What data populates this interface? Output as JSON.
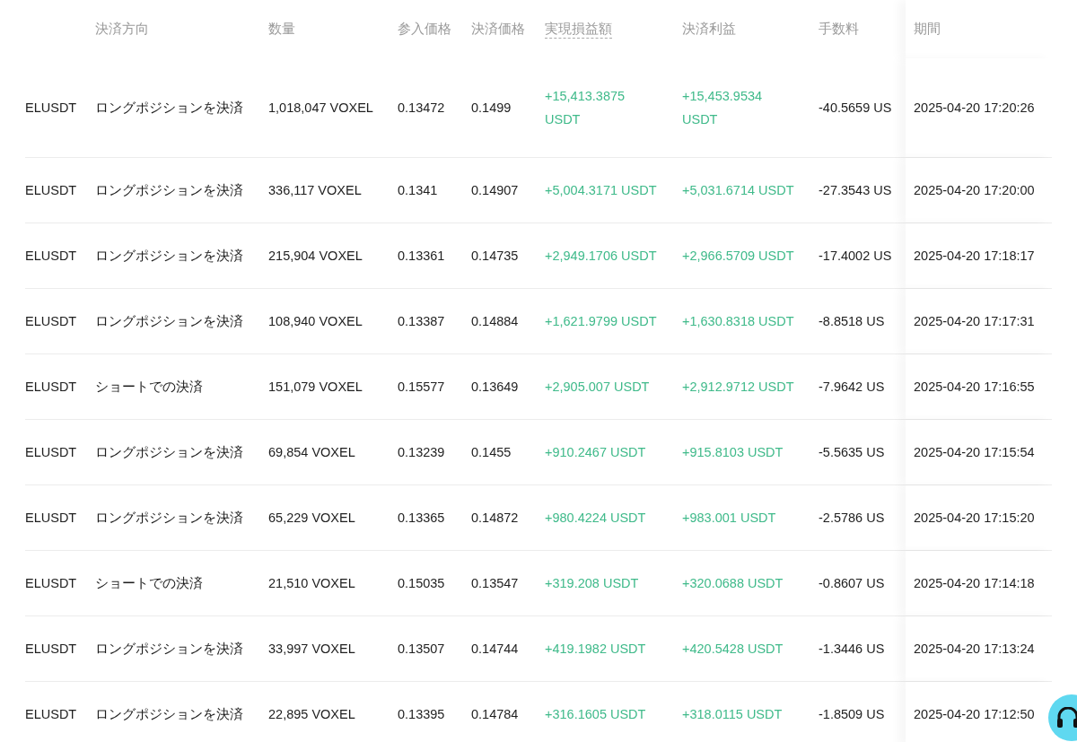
{
  "table": {
    "columns": [
      null,
      {
        "label": "決済方向",
        "dotted_underline": false
      },
      {
        "label": "数量",
        "dotted_underline": false
      },
      {
        "label": "参入価格",
        "dotted_underline": false
      },
      {
        "label": "決済価格",
        "dotted_underline": false
      },
      {
        "label": "実現損益額",
        "dotted_underline": true
      },
      {
        "label": "決済利益",
        "dotted_underline": false
      },
      {
        "label": "手数料",
        "dotted_underline": false
      },
      {
        "label": "期間",
        "dotted_underline": false
      }
    ],
    "rows": [
      [
        "ELUSDT",
        "ロングポジションを決済",
        "1,018,047 VOXEL",
        "0.13472",
        "0.1499",
        "+15,413.3875 USDT",
        "+15,453.9534 USDT",
        "-40.5659 US",
        "2025-04-20 17:20:26"
      ],
      [
        "ELUSDT",
        "ロングポジションを決済",
        "336,117 VOXEL",
        "0.1341",
        "0.14907",
        "+5,004.3171 USDT",
        "+5,031.6714 USDT",
        "-27.3543 US",
        "2025-04-20 17:20:00"
      ],
      [
        "ELUSDT",
        "ロングポジションを決済",
        "215,904 VOXEL",
        "0.13361",
        "0.14735",
        "+2,949.1706 USDT",
        "+2,966.5709 USDT",
        "-17.4002 US",
        "2025-04-20 17:18:17"
      ],
      [
        "ELUSDT",
        "ロングポジションを決済",
        "108,940 VOXEL",
        "0.13387",
        "0.14884",
        "+1,621.9799 USDT",
        "+1,630.8318 USDT",
        "-8.8518 US",
        "2025-04-20 17:17:31"
      ],
      [
        "ELUSDT",
        "ショートでの決済",
        "151,079 VOXEL",
        "0.15577",
        "0.13649",
        "+2,905.007 USDT",
        "+2,912.9712 USDT",
        "-7.9642 US",
        "2025-04-20 17:16:55"
      ],
      [
        "ELUSDT",
        "ロングポジションを決済",
        "69,854 VOXEL",
        "0.13239",
        "0.1455",
        "+910.2467 USDT",
        "+915.8103 USDT",
        "-5.5635 US",
        "2025-04-20 17:15:54"
      ],
      [
        "ELUSDT",
        "ロングポジションを決済",
        "65,229 VOXEL",
        "0.13365",
        "0.14872",
        "+980.4224 USDT",
        "+983.001 USDT",
        "-2.5786 US",
        "2025-04-20 17:15:20"
      ],
      [
        "ELUSDT",
        "ショートでの決済",
        "21,510 VOXEL",
        "0.15035",
        "0.13547",
        "+319.208 USDT",
        "+320.0688 USDT",
        "-0.8607 US",
        "2025-04-20 17:14:18"
      ],
      [
        "ELUSDT",
        "ロングポジションを決済",
        "33,997 VOXEL",
        "0.13507",
        "0.14744",
        "+419.1982 USDT",
        "+420.5428 USDT",
        "-1.3446 US",
        "2025-04-20 17:13:24"
      ],
      [
        "ELUSDT",
        "ロングポジションを決済",
        "22,895 VOXEL",
        "0.13395",
        "0.14784",
        "+316.1605 USDT",
        "+318.0115 USDT",
        "-1.8509 US",
        "2025-04-20 17:12:50"
      ]
    ]
  }
}
